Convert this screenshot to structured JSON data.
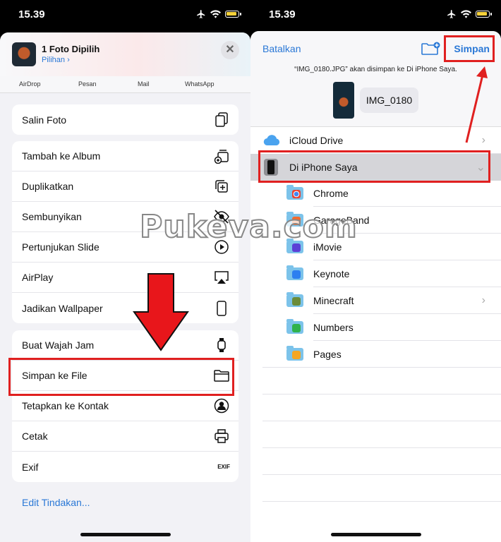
{
  "left": {
    "status": {
      "time": "15.39"
    },
    "header": {
      "title": "1 Foto Dipilih",
      "subtitle": "Pilihan",
      "close": "✕"
    },
    "apps": [
      "AirDrop",
      "Pesan",
      "Mail",
      "WhatsApp"
    ],
    "group1": [
      "Salin Foto"
    ],
    "group2": [
      "Tambah ke Album",
      "Duplikatkan",
      "Sembunyikan",
      "Pertunjukan Slide",
      "AirPlay",
      "Jadikan Wallpaper"
    ],
    "group3": [
      "Buat Wajah Jam",
      "Simpan ke File",
      "Tetapkan ke Kontak",
      "Cetak",
      "Exif"
    ],
    "exif_icon": "EXIF",
    "edit": "Edit Tindakan..."
  },
  "right": {
    "status": {
      "time": "15.39"
    },
    "cancel": "Batalkan",
    "save": "Simpan",
    "message": "“IMG_0180.JPG” akan disimpan ke Di iPhone Saya.",
    "filename": "IMG_0180",
    "locations": [
      "iCloud Drive",
      "Di iPhone Saya"
    ],
    "folders": [
      "Chrome",
      "GarageBand",
      "iMovie",
      "Keynote",
      "Minecraft",
      "Numbers",
      "Pages"
    ]
  },
  "watermark": "Pukeva.com",
  "colors": {
    "link": "#2a78d6",
    "highlight": "#e02020",
    "folder": "#7cc3ea"
  }
}
